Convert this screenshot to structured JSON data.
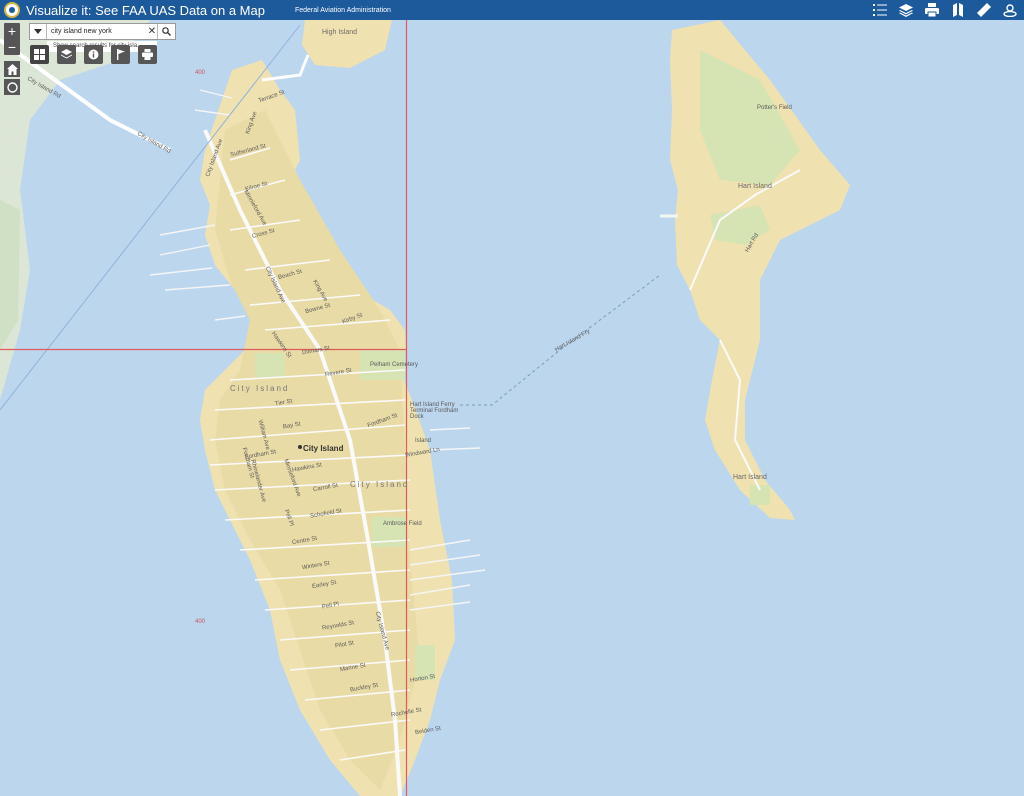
{
  "header": {
    "title": "Visualize it: See FAA UAS Data on a Map",
    "subtitle": "Federal Aviation Administration",
    "tools": [
      "legend-list-icon",
      "layers-icon",
      "print-icon",
      "basemap-icon",
      "measure-icon",
      "share-icon"
    ]
  },
  "map": {
    "zoom_in": "+",
    "zoom_out": "−",
    "search": {
      "value": "city island new york",
      "suggestion": "Show search results for city isla..."
    },
    "widgets": [
      "basemap-gallery-icon",
      "layer-list-icon",
      "info-icon",
      "bookmark-icon",
      "print-widget-icon"
    ],
    "grid_labels": [
      "400",
      "400"
    ],
    "labels": {
      "high_island": "High Island",
      "city_island_area": "City Island",
      "city_island_area2": "City Island",
      "city_island_point": "City Island",
      "hart_island": "Hart Island",
      "hart_island_south": "Hart Island",
      "potters_field": "Potter's Field",
      "hart_island_ferry": "Hart Island Fry",
      "city_island_rd": "City Island Rd",
      "city_island_bridge": "City Island Rd",
      "pelham_cemetery": "Pelham Cemetery",
      "ferry_terminal": "Hart Island Ferry Terminal Fordham Dock",
      "ambrose_field": "Ambrose Field",
      "island_label": "Island"
    },
    "streets": [
      "Terrace St",
      "King Ave",
      "Sutherland St",
      "Kilroe St",
      "Minnieford Ave",
      "Cross St",
      "Beach St",
      "King Ave",
      "Bowne St",
      "Kirby St",
      "Hawkins St",
      "Ditmars St",
      "Revere St",
      "Tier St",
      "Bay St",
      "Fordham St",
      "Fordham St",
      "Hawkins St",
      "Carroll St",
      "Schofield St",
      "Centre St",
      "Winters St",
      "Earley St",
      "Pell Pl",
      "Reynolds St",
      "Pilot St",
      "Marine St",
      "Buckley St",
      "Horton St",
      "Rochelle St",
      "Belden St",
      "Windward Ln",
      "City Island Ave",
      "City Island Ave",
      "William Ave",
      "Fordham St",
      "Rhinelander Ave",
      "Pell Pl",
      "Minnieford Ave",
      "Hart Rd",
      "City Island Ave"
    ],
    "colors": {
      "water": "#bcd6ee",
      "land": "#efe2b0",
      "park": "#d6e3b2",
      "grid_line": "#e05c5c",
      "header": "#1c5a9c"
    }
  }
}
